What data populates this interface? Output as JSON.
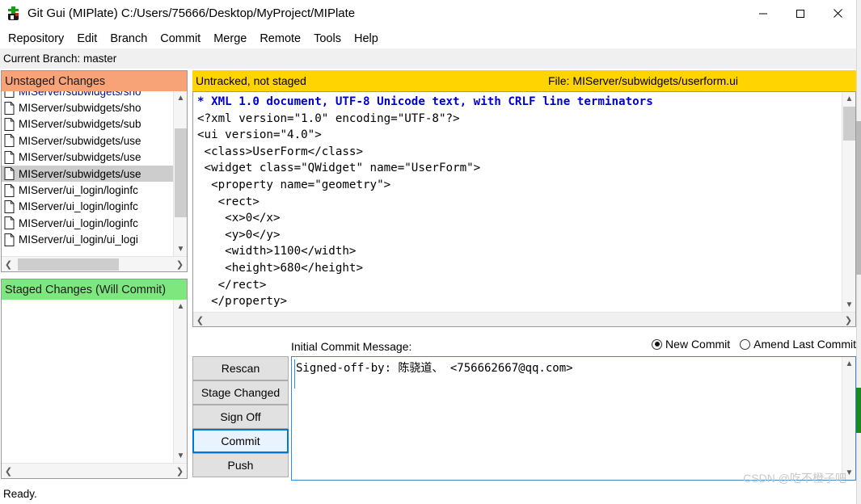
{
  "window": {
    "title": "Git Gui (MIPlate) C:/Users/75666/Desktop/MyProject/MIPlate",
    "icon": "git-gui-icon",
    "minimize_label": "Minimize",
    "maximize_label": "Maximize",
    "close_label": "Close"
  },
  "menubar": {
    "items": [
      {
        "label": "Repository"
      },
      {
        "label": "Edit"
      },
      {
        "label": "Branch"
      },
      {
        "label": "Commit"
      },
      {
        "label": "Merge"
      },
      {
        "label": "Remote"
      },
      {
        "label": "Tools"
      },
      {
        "label": "Help"
      }
    ]
  },
  "branch_bar": {
    "text": "Current Branch: master"
  },
  "unstaged": {
    "header": "Unstaged Changes",
    "header_color": "#f8a278",
    "files": [
      {
        "name": "MIServer/subwidgets/sho",
        "selected": false
      },
      {
        "name": "MIServer/subwidgets/sho",
        "selected": false
      },
      {
        "name": "MIServer/subwidgets/sub",
        "selected": false
      },
      {
        "name": "MIServer/subwidgets/use",
        "selected": false
      },
      {
        "name": "MIServer/subwidgets/use",
        "selected": false
      },
      {
        "name": "MIServer/subwidgets/use",
        "selected": true
      },
      {
        "name": "MIServer/ui_login/loginfc",
        "selected": false
      },
      {
        "name": "MIServer/ui_login/loginfc",
        "selected": false
      },
      {
        "name": "MIServer/ui_login/loginfc",
        "selected": false
      },
      {
        "name": "MIServer/ui_login/ui_logi",
        "selected": false
      }
    ]
  },
  "staged": {
    "header": "Staged Changes (Will Commit)",
    "header_color": "#7ee87e",
    "files": []
  },
  "diff": {
    "status": "Untracked, not staged",
    "file_label": "File:  MIServer/subwidgets/userform.ui",
    "header_color": "#ffd400",
    "header_line": "* XML 1.0 document, UTF-8 Unicode text, with CRLF line terminators",
    "body": "<?xml version=\"1.0\" encoding=\"UTF-8\"?>\n<ui version=\"4.0\">\n <class>UserForm</class>\n <widget class=\"QWidget\" name=\"UserForm\">\n  <property name=\"geometry\">\n   <rect>\n    <x>0</x>\n    <y>0</y>\n    <width>1100</width>\n    <height>680</height>\n   </rect>\n  </property>\n  <property name=\"windowTitle\">\n   <string>Form</string>\n  </property>"
  },
  "buttons": [
    {
      "label": "Rescan",
      "focused": false
    },
    {
      "label": "Stage Changed",
      "focused": false
    },
    {
      "label": "Sign Off",
      "focused": false
    },
    {
      "label": "Commit",
      "focused": true
    },
    {
      "label": "Push",
      "focused": false
    }
  ],
  "commit": {
    "label": "Initial Commit Message:",
    "new_commit_label": "New Commit",
    "amend_label": "Amend Last Commit",
    "selected_mode": "New Commit",
    "message": "Signed-off-by: 陈骁道、 <756662667@qq.com>"
  },
  "statusbar": {
    "text": "Ready."
  },
  "watermark": {
    "text": "CSDN @吃不橙子吧"
  }
}
